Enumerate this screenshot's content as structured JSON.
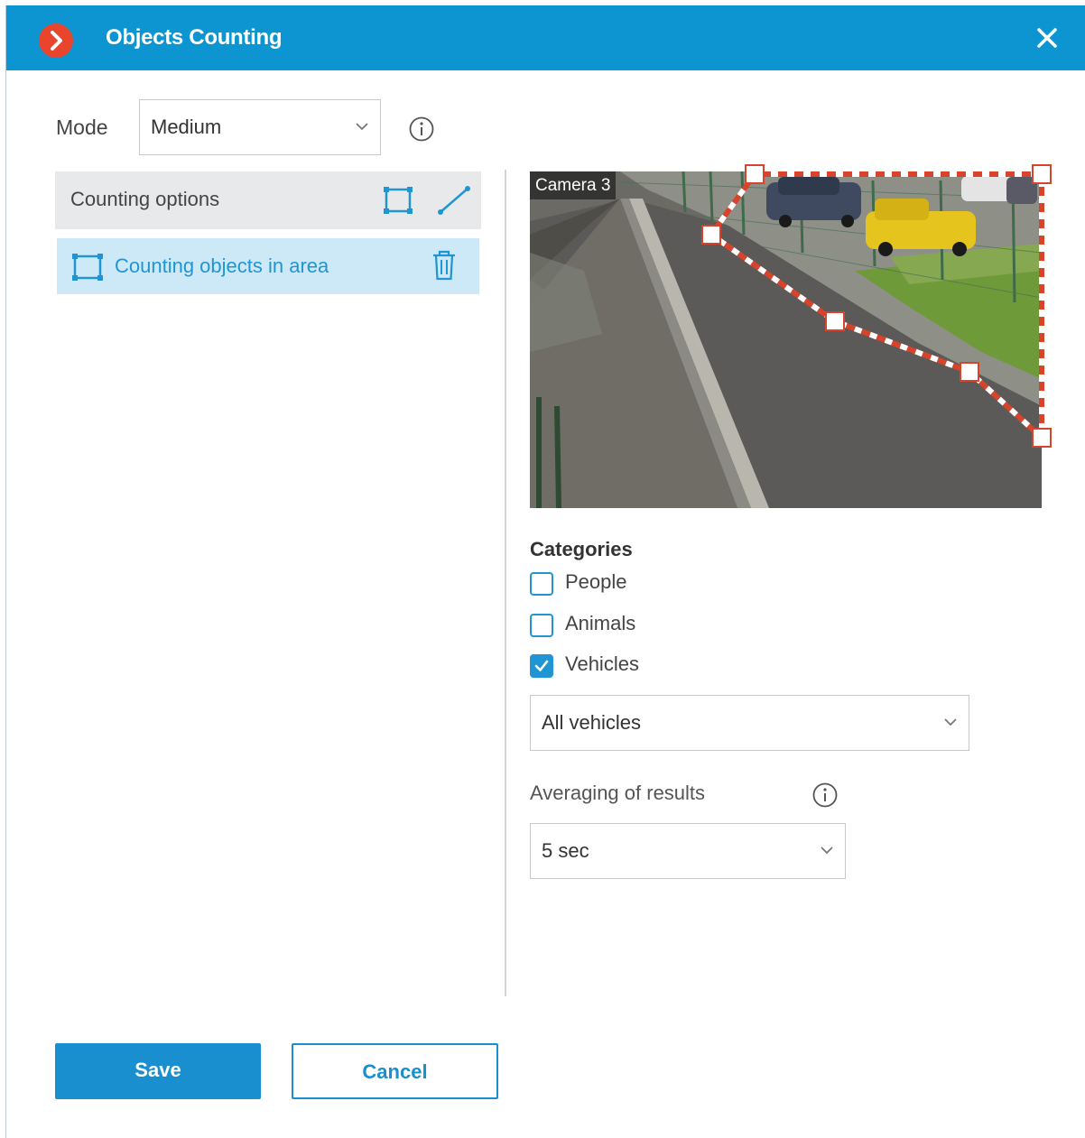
{
  "window": {
    "title": "Objects Counting",
    "accent_color": "#0c95d1",
    "logo_color": "#e8452c"
  },
  "mode": {
    "label": "Mode",
    "selected": "Medium",
    "info_icon": "info-icon"
  },
  "counting_options": {
    "header_label": "Counting options",
    "tools": [
      "area-tool-icon",
      "line-tool-icon"
    ],
    "items": [
      {
        "label": "Counting objects in area",
        "icon": "rectangle-area-icon",
        "delete_icon": "trash-icon",
        "selected": true
      }
    ]
  },
  "camera": {
    "label": "Camera 3",
    "zone_color": "#d8432b"
  },
  "categories": {
    "title": "Categories",
    "items": [
      {
        "label": "People",
        "checked": false
      },
      {
        "label": "Animals",
        "checked": false
      },
      {
        "label": "Vehicles",
        "checked": true
      }
    ],
    "vehicle_type": "All vehicles"
  },
  "averaging": {
    "label": "Averaging of results",
    "selected": "5 sec",
    "info_icon": "info-icon"
  },
  "buttons": {
    "save": "Save",
    "cancel": "Cancel"
  }
}
